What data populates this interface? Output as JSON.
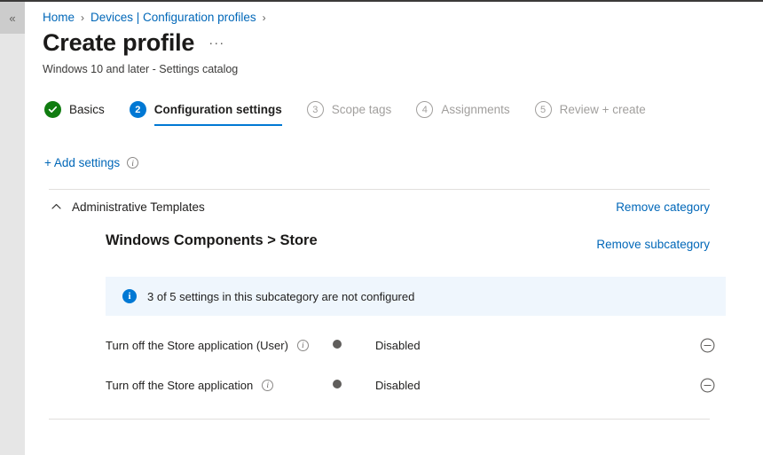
{
  "left_rail": {
    "collapse_glyph": "«"
  },
  "breadcrumb": {
    "items": [
      "Home",
      "Devices | Configuration profiles"
    ],
    "separator": "›"
  },
  "header": {
    "title": "Create profile",
    "more_label": "···",
    "subtitle": "Windows 10 and later - Settings catalog"
  },
  "wizard": {
    "steps": [
      {
        "num": "1",
        "label": "Basics",
        "state": "done"
      },
      {
        "num": "2",
        "label": "Configuration settings",
        "state": "active"
      },
      {
        "num": "3",
        "label": "Scope tags",
        "state": "todo"
      },
      {
        "num": "4",
        "label": "Assignments",
        "state": "todo"
      },
      {
        "num": "5",
        "label": "Review + create",
        "state": "todo"
      }
    ]
  },
  "add_settings": {
    "label": "+ Add settings",
    "info_glyph": "i"
  },
  "category": {
    "name": "Administrative Templates",
    "remove_label": "Remove category",
    "collapsed": false
  },
  "subcategory": {
    "title": "Windows Components > Store",
    "remove_label": "Remove subcategory"
  },
  "banner": {
    "icon_glyph": "i",
    "text": "3 of 5 settings in this subcategory are not configured"
  },
  "settings": [
    {
      "label": "Turn off the Store application (User)",
      "info_glyph": "i",
      "toggle_state": "Disabled",
      "toggle_on": false
    },
    {
      "label": "Turn off the Store application",
      "info_glyph": "i",
      "toggle_state": "Disabled",
      "toggle_on": false
    }
  ],
  "colors": {
    "accent": "#0078d4",
    "link": "#0067b8",
    "success": "#107c10",
    "banner_bg": "#eff6fd"
  }
}
